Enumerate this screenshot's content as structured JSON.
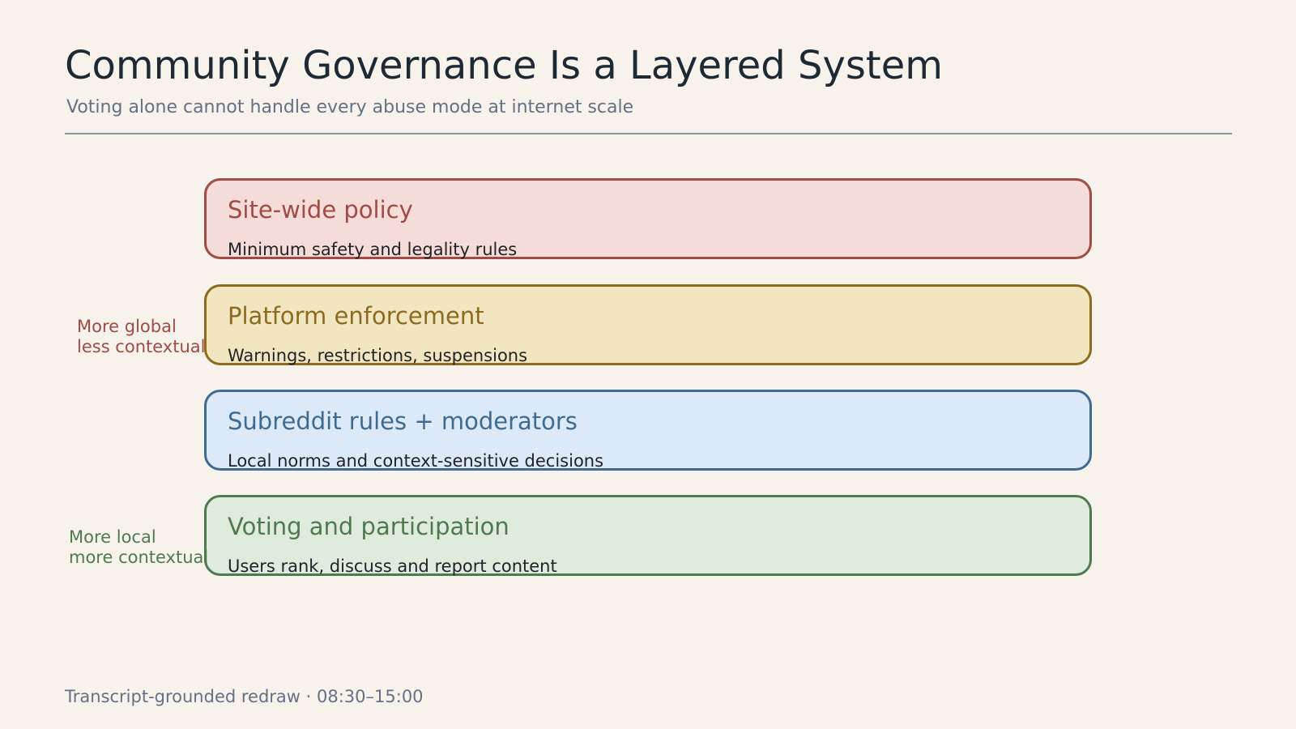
{
  "slide": {
    "title": "Community Governance Is a Layered System",
    "subtitle": "Voting alone cannot handle every abuse mode at internet scale",
    "footer": "Transcript-grounded redraw · 08:30–15:00"
  },
  "layers": [
    {
      "name": "Site-wide policy",
      "description": "Minimum safety and legality rules",
      "accent": "#a14b45",
      "fill": "#f5dcd8"
    },
    {
      "name": "Platform enforcement",
      "description": "Warnings, restrictions, suspensions",
      "accent": "#8a6b1f",
      "fill": "#f2e6c0"
    },
    {
      "name": "Subreddit rules + moderators",
      "description": "Local norms and context-sensitive decisions",
      "accent": "#3f6b91",
      "fill": "#dce9f6"
    },
    {
      "name": "Voting and participation",
      "description": "Users rank, discuss and report content",
      "accent": "#4f7a4f",
      "fill": "#deebdd"
    }
  ],
  "side_labels": {
    "top": {
      "line1": "More global",
      "line2": "less contextual",
      "color": "#a14b45"
    },
    "bottom": {
      "line1": "More local",
      "line2": "more contextual",
      "color": "#4f7a4f"
    }
  }
}
